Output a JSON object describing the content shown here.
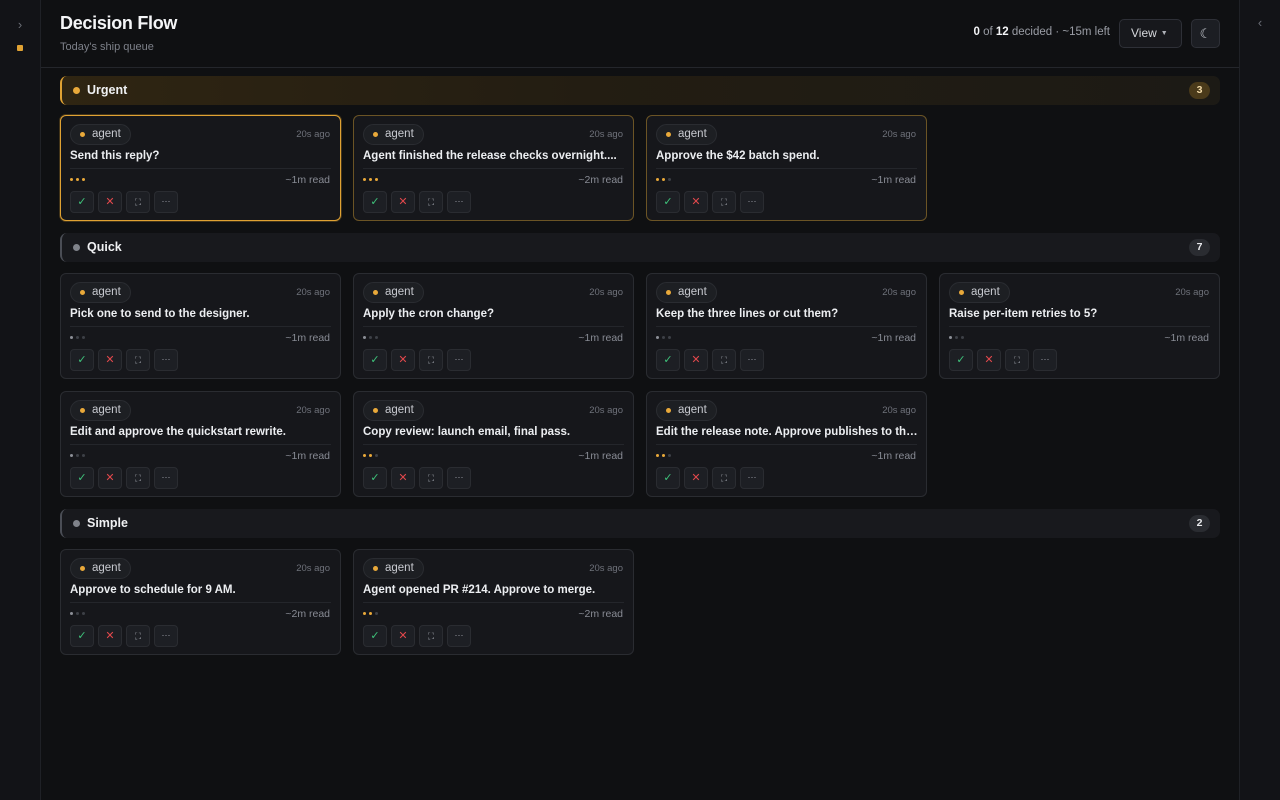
{
  "app": {
    "title": "Decision Flow",
    "subtitle": "Today's ship queue"
  },
  "left_rail": {
    "toggle_icon": "›"
  },
  "right_rail": {
    "toggle_icon": "‹"
  },
  "header": {
    "progress": {
      "decided": "0",
      "of_label": " of ",
      "total": "12",
      "suffix": " decided · ~15m left"
    },
    "view_label": "View",
    "theme_icon": "☾"
  },
  "action_icons": {
    "approve": "✓",
    "reject": "✕",
    "expand": "⛶",
    "more": "···"
  },
  "sections": [
    {
      "title": "Urgent",
      "count": "3",
      "cards": [
        {
          "chip": "agent",
          "time": "20s ago",
          "title": "Send this reply?",
          "level": 3,
          "read": "~1m read"
        },
        {
          "chip": "agent",
          "time": "20s ago",
          "title": "Agent finished the release checks overnight....",
          "level": 3,
          "read": "~2m read"
        },
        {
          "chip": "agent",
          "time": "20s ago",
          "title": "Approve the $42 batch spend.",
          "level": 2,
          "read": "~1m read"
        }
      ]
    },
    {
      "title": "Quick",
      "count": "7",
      "cards": [
        {
          "chip": "agent",
          "time": "20s ago",
          "title": "Pick one to send to the designer.",
          "level": 1,
          "read": "~1m read"
        },
        {
          "chip": "agent",
          "time": "20s ago",
          "title": "Apply the cron change?",
          "level": 1,
          "read": "~1m read"
        },
        {
          "chip": "agent",
          "time": "20s ago",
          "title": "Keep the three lines or cut them?",
          "level": 1,
          "read": "~1m read"
        },
        {
          "chip": "agent",
          "time": "20s ago",
          "title": "Raise per-item retries to 5?",
          "level": 1,
          "read": "~1m read"
        },
        {
          "chip": "agent",
          "time": "20s ago",
          "title": "Edit and approve the quickstart rewrite.",
          "level": 1,
          "read": "~1m read"
        },
        {
          "chip": "agent",
          "time": "20s ago",
          "title": "Copy review: launch email, final pass.",
          "level": 2,
          "read": "~1m read"
        },
        {
          "chip": "agent",
          "time": "20s ago",
          "title": "Edit the release note. Approve publishes to the...",
          "level": 2,
          "read": "~1m read"
        }
      ]
    },
    {
      "title": "Simple",
      "count": "2",
      "cards": [
        {
          "chip": "agent",
          "time": "20s ago",
          "title": "Approve to schedule for 9 AM.",
          "level": 1,
          "read": "~2m read"
        },
        {
          "chip": "agent",
          "time": "20s ago",
          "title": "Agent opened PR #214. Approve to merge.",
          "level": 2,
          "read": "~2m read"
        }
      ]
    }
  ]
}
